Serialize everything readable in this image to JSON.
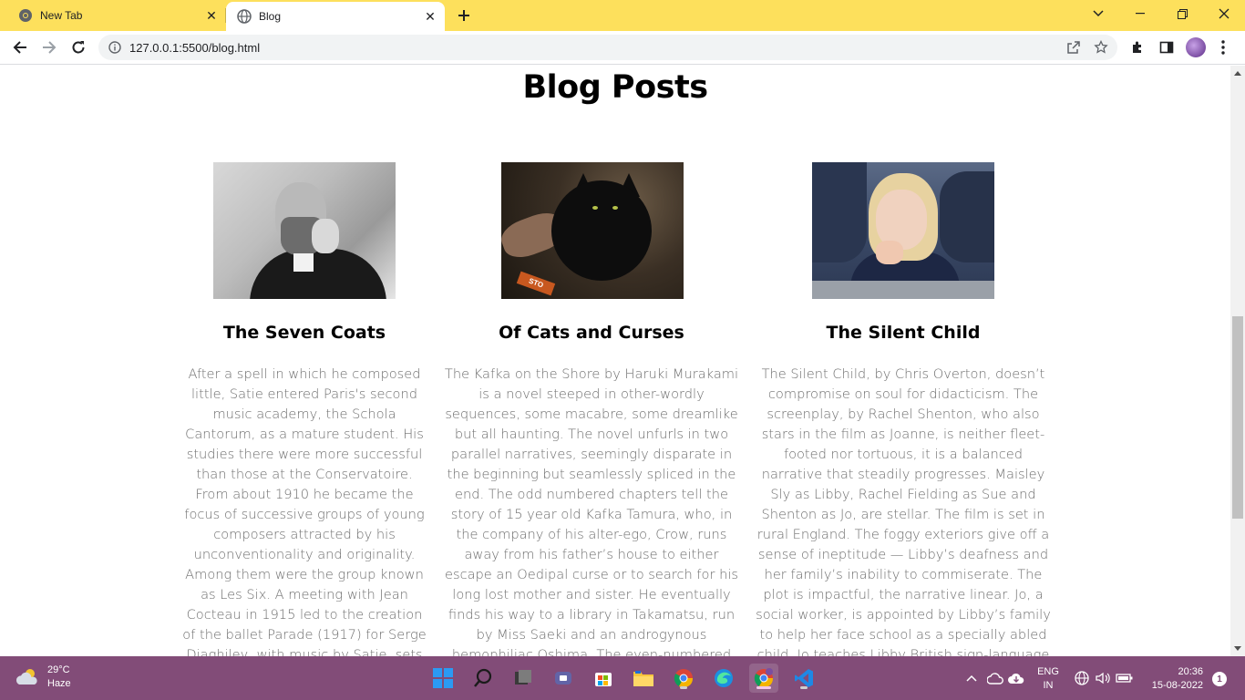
{
  "browser": {
    "tabs": [
      {
        "title": "New Tab"
      },
      {
        "title": "Blog"
      }
    ],
    "url": "127.0.0.1:5500/blog.html",
    "colors": {
      "tab_strip": "#fde05c",
      "taskbar": "#824c78"
    }
  },
  "page": {
    "title": "Blog Posts",
    "posts": [
      {
        "title": "The Seven Coats",
        "body": "After a spell in which he composed little, Satie entered Paris's second music academy, the Schola Cantorum, as a mature student. His studies there were more successful than those at the Conservatoire. From about 1910 he became the focus of successive groups of young composers attracted by his unconventionality and originality. Among them were the group known as Les Six. A meeting with Jean Cocteau in 1915 led to the creation of the ballet Parade (1917) for Serge Diaghilev, with music by Satie, sets and"
      },
      {
        "title": "Of Cats and Curses",
        "body": "The Kafka on the Shore by Haruki Murakami is a novel steeped in other-wordly sequences, some macabre, some dreamlike but all haunting. The novel unfurls in two parallel narratives, seemingly disparate in the beginning but seamlessly spliced in the end. The odd numbered chapters tell the story of 15 year old Kafka Tamura, who, in the company of his alter-ego, Crow, runs away from his father’s house to either escape an Oedipal curse or to search for his long lost mother and sister. He eventually finds his way to a library in Takamatsu, run by Miss Saeki and an androgynous hemophiliac Oshima. The even-numbered chapters tell Nakata’s story, who as"
      },
      {
        "title": "The Silent Child",
        "body": "The Silent Child, by Chris Overton, doesn’t compromise on soul for didacticism. The screenplay, by Rachel Shenton, who also stars in the film as Joanne, is neither fleet-footed nor tortuous, it is a balanced narrative that steadily progresses. Maisley Sly as Libby, Rachel Fielding as Sue and Shenton as Jo, are stellar. The film is set in rural England. The foggy exteriors give off a sense of ineptitude — Libby’s deafness and her family’s inability to commiserate. The plot is impactful, the narrative linear. Jo, a social worker, is appointed by Libby’s family to help her face school as a specially abled child. Jo teaches Libby British sign-language and they quickly"
      }
    ],
    "cat_photo_tag": "STO"
  },
  "taskbar": {
    "weather_temp": "29°C",
    "weather_desc": "Haze",
    "lang": "ENG",
    "region": "IN",
    "time": "20:36",
    "date": "15-08-2022",
    "notifications": "1"
  }
}
